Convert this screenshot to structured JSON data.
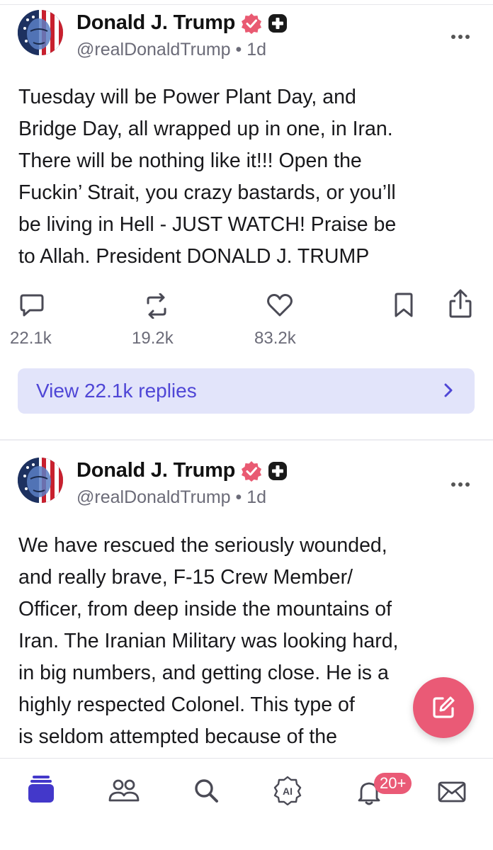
{
  "colors": {
    "accent": "#4f46d6",
    "replies_bg": "#e2e4fa",
    "fab": "#ea5a76",
    "verified": "#e95a72",
    "muted": "#6b6b78"
  },
  "posts": [
    {
      "author": "Donald J. Trump",
      "handle": "@realDonaldTrump",
      "time_sep": "•",
      "time": "1d",
      "text": "Tuesday will be Power Plant Day, and\nBridge Day, all wrapped up in one, in Iran.\nThere will be nothing like it!!! Open the\nFuckin’ Strait, you crazy bastards, or you’ll\nbe living in Hell - JUST WATCH! Praise be\nto Allah. President DONALD J. TRUMP",
      "replies_count": "22.1k",
      "reposts_count": "19.2k",
      "likes_count": "83.2k",
      "view_replies_label": "View 22.1k replies"
    },
    {
      "author": "Donald J. Trump",
      "handle": "@realDonaldTrump",
      "time_sep": "•",
      "time": "1d",
      "text": "We have rescued the seriously wounded,\nand really brave, F-15 Crew Member/\nOfficer, from deep inside the mountains of\nIran. The Iranian Military was looking hard,\nin big numbers, and getting close. He is a\nhighly respected Colonel. This type of\nis seldom attempted because of the"
    }
  ],
  "nav": {
    "icons": [
      "home-icon",
      "groups-icon",
      "search-icon",
      "ai-icon",
      "notifications-icon",
      "messages-icon"
    ],
    "notifications_badge": "20+",
    "ai_label": "AI"
  }
}
